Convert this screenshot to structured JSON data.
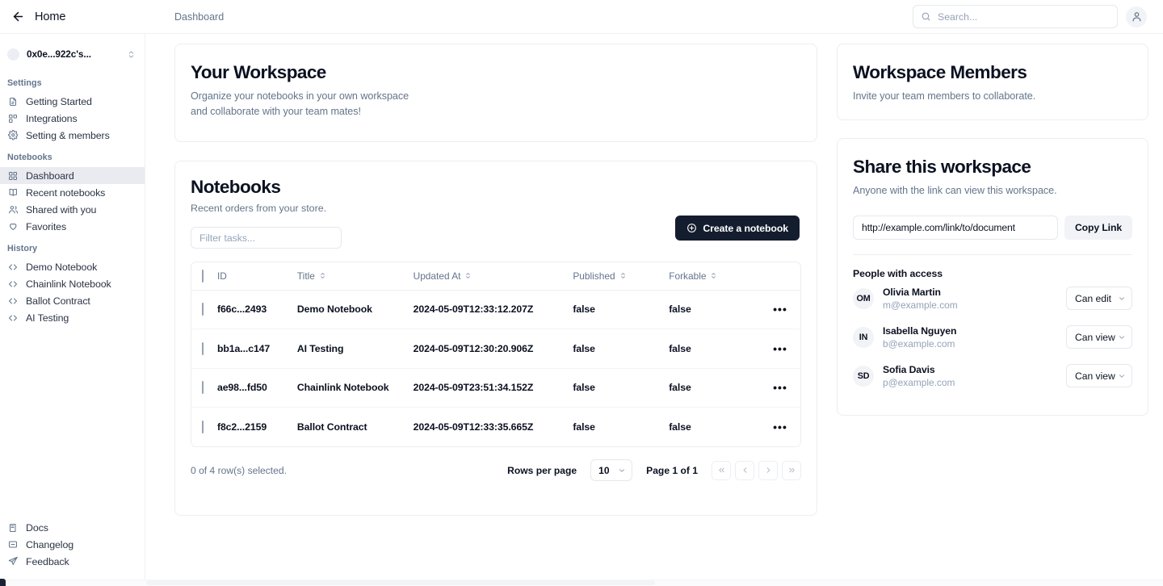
{
  "topbar": {
    "back_icon": "arrow-left-icon",
    "home_label": "Home",
    "breadcrumb": "Dashboard",
    "search": {
      "icon": "search-icon",
      "placeholder": "Search..."
    },
    "account_icon": "user-avatar-icon"
  },
  "sidebar": {
    "workspace": {
      "name": "0x0e...922c's...",
      "chevron_icon": "chevron-up-down-icon"
    },
    "groups": [
      {
        "title": "Settings",
        "items": [
          {
            "label": "Getting Started",
            "icon": "file-text-icon",
            "active": false
          },
          {
            "label": "Integrations",
            "icon": "blocks-icon",
            "active": false
          },
          {
            "label": "Setting & members",
            "icon": "gear-icon",
            "active": false
          }
        ]
      },
      {
        "title": "Notebooks",
        "items": [
          {
            "label": "Dashboard",
            "icon": "layout-grid-icon",
            "active": true
          },
          {
            "label": "Recent notebooks",
            "icon": "book-open-icon",
            "active": false
          },
          {
            "label": "Shared with you",
            "icon": "users-icon",
            "active": false
          },
          {
            "label": "Favorites",
            "icon": "heart-icon",
            "active": false
          }
        ]
      },
      {
        "title": "History",
        "items": [
          {
            "label": "Demo Notebook",
            "icon": "code-brackets-icon",
            "active": false
          },
          {
            "label": "Chainlink Notebook",
            "icon": "code-brackets-icon",
            "active": false
          },
          {
            "label": "Ballot Contract",
            "icon": "code-brackets-icon",
            "active": false
          },
          {
            "label": "AI Testing",
            "icon": "code-brackets-icon",
            "active": false
          }
        ]
      }
    ],
    "footer_items": [
      {
        "label": "Docs",
        "icon": "book-icon"
      },
      {
        "label": "Changelog",
        "icon": "message-square-icon"
      },
      {
        "label": "Feedback",
        "icon": "send-icon"
      }
    ]
  },
  "workspace_card": {
    "title": "Your Workspace",
    "description_line1": "Organize your notebooks in your own workspace",
    "description_line2": "and collaborate with your team mates!"
  },
  "notebooks": {
    "title": "Notebooks",
    "subtitle": "Recent orders from your store.",
    "create_button": {
      "label": "Create a notebook",
      "icon": "plus-circle-icon"
    },
    "filter_placeholder": "Filter tasks...",
    "columns": [
      {
        "key": "checkbox",
        "label": "",
        "sortable": false
      },
      {
        "key": "id",
        "label": "ID",
        "sortable": false
      },
      {
        "key": "title",
        "label": "Title",
        "sortable": true
      },
      {
        "key": "updated_at",
        "label": "Updated At",
        "sortable": true
      },
      {
        "key": "published",
        "label": "Published",
        "sortable": true
      },
      {
        "key": "forkable",
        "label": "Forkable",
        "sortable": true
      },
      {
        "key": "actions",
        "label": "",
        "sortable": false
      }
    ],
    "rows": [
      {
        "id": "f66c...2493",
        "title": "Demo Notebook",
        "updated_at": "2024-05-09T12:33:12.207Z",
        "published": "false",
        "forkable": "false",
        "selected": false,
        "actions_icon": "ellipsis-horizontal-icon"
      },
      {
        "id": "bb1a...c147",
        "title": "AI Testing",
        "updated_at": "2024-05-09T12:30:20.906Z",
        "published": "false",
        "forkable": "false",
        "selected": false,
        "actions_icon": "ellipsis-horizontal-icon"
      },
      {
        "id": "ae98...fd50",
        "title": "Chainlink Notebook",
        "updated_at": "2024-05-09T23:51:34.152Z",
        "published": "false",
        "forkable": "false",
        "selected": false,
        "actions_icon": "ellipsis-horizontal-icon"
      },
      {
        "id": "f8c2...2159",
        "title": "Ballot Contract",
        "updated_at": "2024-05-09T12:33:35.665Z",
        "published": "false",
        "forkable": "false",
        "selected": false,
        "actions_icon": "ellipsis-horizontal-icon"
      }
    ],
    "pagination": {
      "selection_text": "0 of 4 row(s) selected.",
      "rows_per_page_label": "Rows per page",
      "rows_per_page_value": "10",
      "page_text": "Page 1 of 1",
      "first_icon": "chevrons-left-icon",
      "prev_icon": "chevron-left-icon",
      "next_icon": "chevron-right-icon",
      "last_icon": "chevrons-right-icon"
    }
  },
  "members_card": {
    "title": "Workspace Members",
    "subtitle": "Invite your team members to collaborate."
  },
  "share_card": {
    "title": "Share this workspace",
    "subtitle": "Anyone with the link can view this workspace.",
    "link_value": "http://example.com/link/to/document",
    "copy_label": "Copy Link",
    "people_title": "People with access",
    "people": [
      {
        "initials": "OM",
        "name": "Olivia Martin",
        "email": "m@example.com",
        "permission": "Can edit"
      },
      {
        "initials": "IN",
        "name": "Isabella Nguyen",
        "email": "b@example.com",
        "permission": "Can view"
      },
      {
        "initials": "SD",
        "name": "Sofia Davis",
        "email": "p@example.com",
        "permission": "Can view"
      }
    ]
  },
  "colors": {
    "accent_dark": "#141d2e",
    "page_bg": "#ffffff",
    "border": "#eceef2",
    "muted_text": "#64748b",
    "active_nav_bg": "#e9ebf0"
  }
}
